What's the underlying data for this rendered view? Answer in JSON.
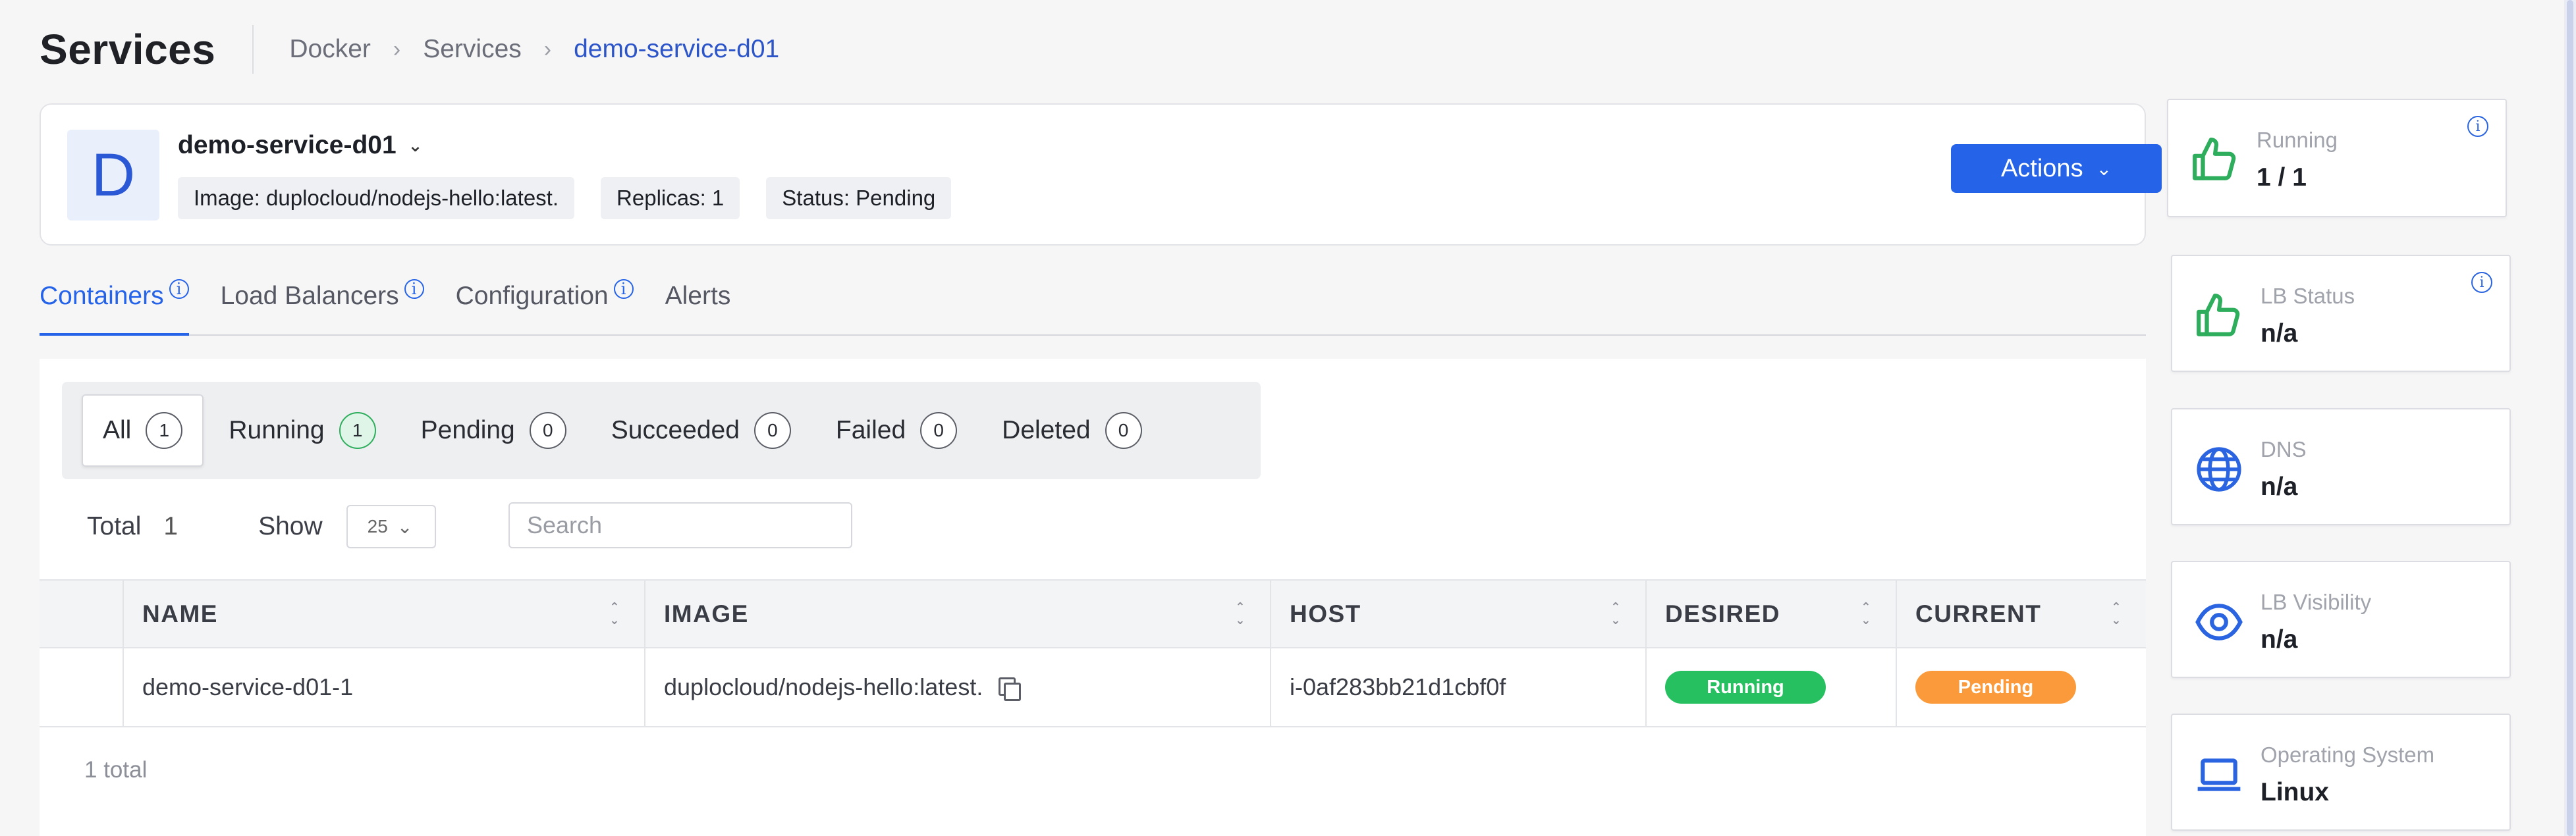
{
  "header": {
    "title": "Services",
    "breadcrumb": [
      "Docker",
      "Services",
      "demo-service-d01"
    ]
  },
  "service": {
    "avatar_letter": "D",
    "name": "demo-service-d01",
    "image_badge": "Image: duplocloud/nodejs-hello:latest.",
    "replicas_badge": "Replicas: 1",
    "status_badge": "Status: Pending",
    "actions_label": "Actions"
  },
  "tabs": [
    {
      "label": "Containers",
      "active": true,
      "info": true
    },
    {
      "label": "Load Balancers",
      "active": false,
      "info": true
    },
    {
      "label": "Configuration",
      "active": false,
      "info": true
    },
    {
      "label": "Alerts",
      "active": false,
      "info": false
    }
  ],
  "filters": [
    {
      "label": "All",
      "count": "1"
    },
    {
      "label": "Running",
      "count": "1"
    },
    {
      "label": "Pending",
      "count": "0"
    },
    {
      "label": "Succeeded",
      "count": "0"
    },
    {
      "label": "Failed",
      "count": "0"
    },
    {
      "label": "Deleted",
      "count": "0"
    }
  ],
  "totals": {
    "total_label": "Total",
    "total_value": "1",
    "show_label": "Show",
    "page_size": "25",
    "search_placeholder": "Search"
  },
  "table": {
    "columns": [
      "NAME",
      "IMAGE",
      "HOST",
      "DESIRED",
      "CURRENT"
    ],
    "rows": [
      {
        "name": "demo-service-d01-1",
        "image": "duplocloud/nodejs-hello:latest.",
        "host": "i-0af283bb21d1cbf0f",
        "desired": "Running",
        "current": "Pending"
      }
    ],
    "footer": "1 total"
  },
  "stats": [
    {
      "label": "Running",
      "value": "1 / 1",
      "icon": "thumbs-up-icon",
      "info": true
    },
    {
      "label": "LB Status",
      "value": "n/a",
      "icon": "thumbs-up-icon",
      "info": true
    },
    {
      "label": "DNS",
      "value": "n/a",
      "icon": "globe-icon",
      "info": false
    },
    {
      "label": "LB Visibility",
      "value": "n/a",
      "icon": "eye-icon",
      "info": false
    },
    {
      "label": "Operating System",
      "value": "Linux",
      "icon": "laptop-icon",
      "info": false
    }
  ],
  "colors": {
    "accent": "#2563e8",
    "running": "#27c060",
    "pending": "#fb9a3a",
    "thumbs": "#2eae5d"
  }
}
